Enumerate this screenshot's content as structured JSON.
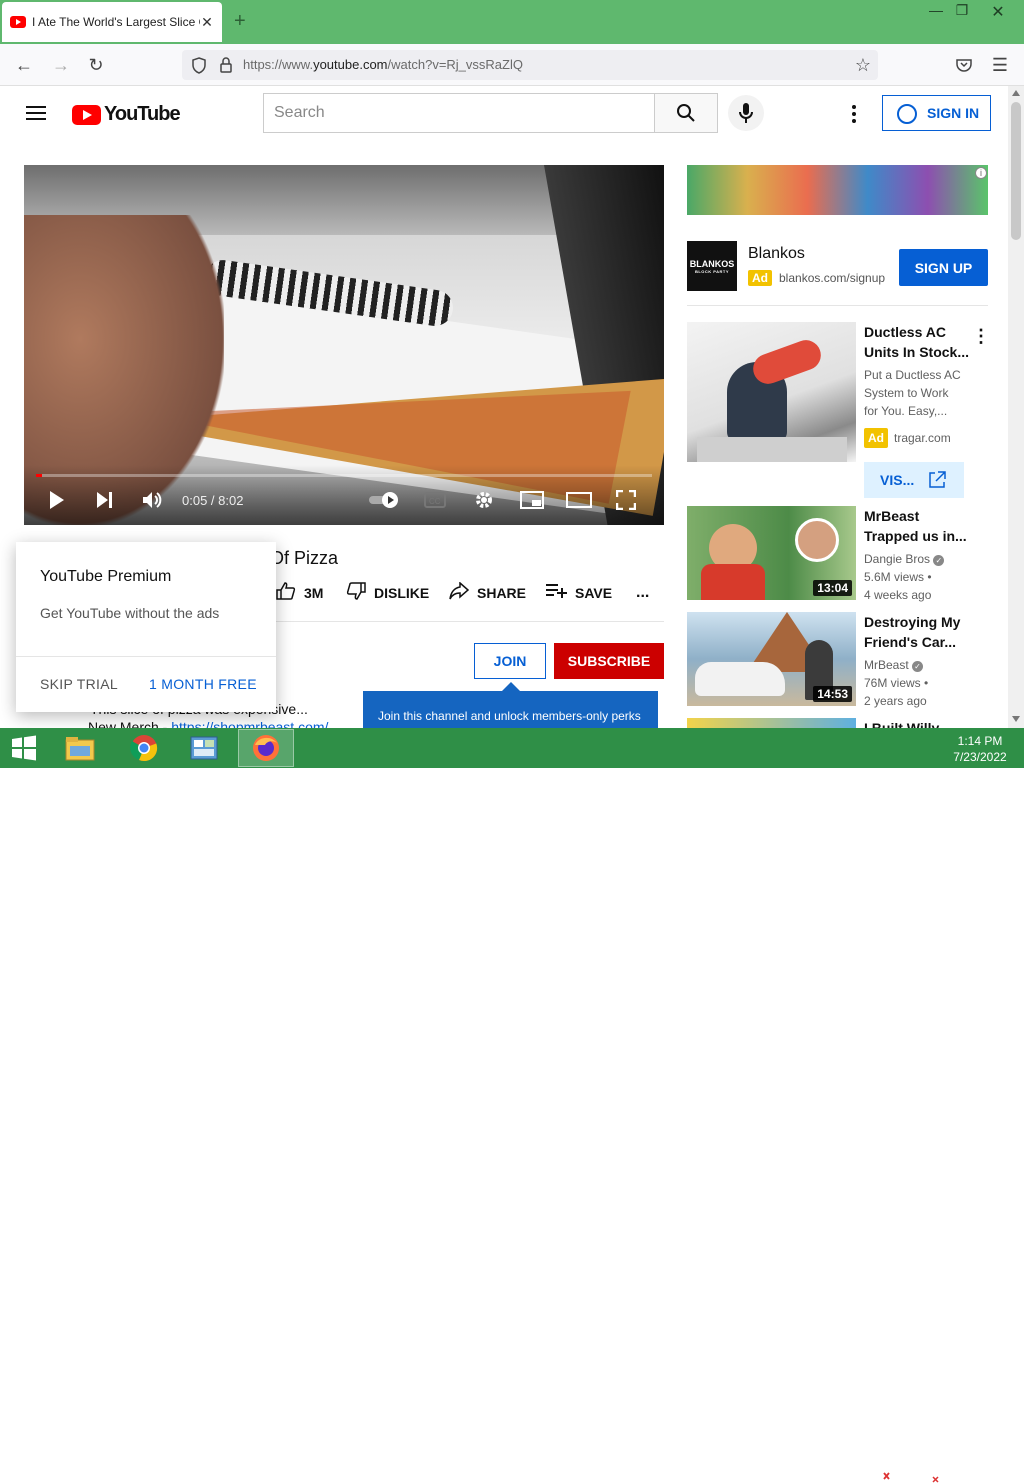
{
  "browser": {
    "tab_title": "I Ate The World's Largest Slice Of Pizza",
    "tab_close": "✕",
    "new_tab": "+",
    "url_prefix": "https://www.",
    "url_domain": "youtube.com",
    "url_path": "/watch?v=Rj_vssRaZlQ"
  },
  "youtube_header": {
    "logo_text": "YouTube",
    "search_placeholder": "Search",
    "sign_in": "SIGN IN"
  },
  "player": {
    "time": "0:05 / 8:02",
    "progress_fraction": 0.0104
  },
  "video": {
    "title_visible": "Of Pizza",
    "likes": "3M",
    "dislike": "DISLIKE",
    "share": "SHARE",
    "save": "SAVE",
    "more": "...",
    "join": "JOIN",
    "subscribe": "SUBSCRIBE",
    "desc_line1": "This slice of pizza was expensive...",
    "desc_line2_prefix": "New Merch - ",
    "desc_line2_link": "https://shopmrbeast.com/",
    "join_tooltip": "Join this channel and unlock members-only perks"
  },
  "premium_popup": {
    "heading": "YouTube Premium",
    "subtext": "Get YouTube without the ads",
    "skip": "SKIP TRIAL",
    "free": "1 MONTH FREE"
  },
  "ad": {
    "info": "i",
    "logo_text": "BLANKOS",
    "logo_subtext": "BLOCK PARTY",
    "name": "Blankos",
    "badge": "Ad",
    "url": "blankos.com/signup",
    "cta": "SIGN UP"
  },
  "related": [
    {
      "title_line1": "Ductless AC",
      "title_line2": "Units In Stock...",
      "desc": [
        "Put a Ductless AC",
        "System to Work",
        "for You. Easy,..."
      ],
      "badge": "Ad",
      "domain": "tragar.com",
      "cta": "VIS..."
    },
    {
      "title_line1": "MrBeast",
      "title_line2": "Trapped us in...",
      "channel": "Dangie Bros",
      "views": "5.6M views •",
      "age": "4 weeks ago",
      "duration": "13:04"
    },
    {
      "title_line1": "Destroying My",
      "title_line2": "Friend's Car...",
      "channel": "MrBeast",
      "views": "76M views •",
      "age": "2 years ago",
      "duration": "14:53"
    },
    {
      "title_line1": "I Built Willy"
    }
  ],
  "taskbar": {
    "time": "1:14 PM",
    "date": "7/23/2022"
  },
  "colors": {
    "taskbar": "#2f8f47",
    "tabstrip": "#5fb86e",
    "yt_red": "#ff0000",
    "link_blue": "#065fd4",
    "subscribe_red": "#cc0000"
  }
}
